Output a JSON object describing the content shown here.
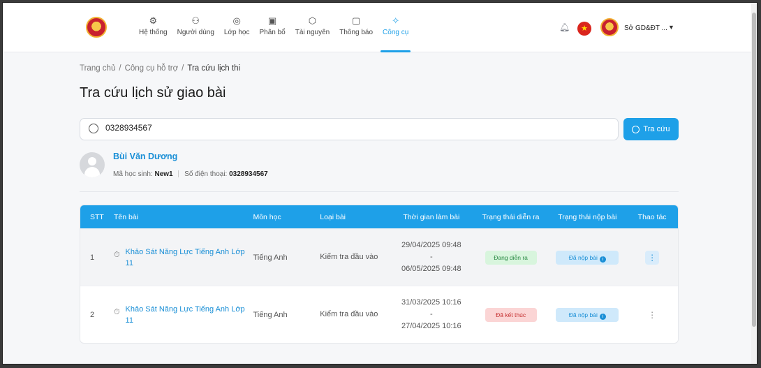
{
  "header": {
    "nav": [
      {
        "label": "Hệ thống",
        "icon": "gear-icon",
        "glyph": "⚙"
      },
      {
        "label": "Người dùng",
        "icon": "users-icon",
        "glyph": "⚇"
      },
      {
        "label": "Lớp học",
        "icon": "graduation-cap-icon",
        "glyph": "◎"
      },
      {
        "label": "Phân bổ",
        "icon": "allocation-icon",
        "glyph": "▣"
      },
      {
        "label": "Tài nguyên",
        "icon": "box-icon",
        "glyph": "⬡"
      },
      {
        "label": "Thông báo",
        "icon": "notification-icon",
        "glyph": "▢"
      },
      {
        "label": "Công cụ",
        "icon": "magic-wand-icon",
        "glyph": "✧"
      }
    ],
    "active_nav": "Công cụ",
    "user_name": "Sở GD&ĐT ...",
    "accent_color": "#1ea0e8"
  },
  "breadcrumb": [
    "Trang chủ",
    "/",
    "Công cụ hỗ trợ",
    "/",
    "Tra cứu lịch thi"
  ],
  "page_title": "Tra cứu lịch sử giao bài",
  "search": {
    "value": "0328934567",
    "button_label": "Tra cứu"
  },
  "student": {
    "name": "Bùi Văn Dương",
    "id_label": "Mã học sinh:",
    "id_value": "New1",
    "phone_label": "Số điện thoại:",
    "phone_value": "0328934567"
  },
  "table": {
    "columns": [
      "STT",
      "Tên bài",
      "Môn học",
      "Loại bài",
      "Thời gian làm bài",
      "Trạng thái diễn ra",
      "Trạng thái nộp bài",
      "Thao tác"
    ],
    "rows": [
      {
        "stt": "1",
        "name": "Khảo Sát Năng Lực Tiếng Anh Lớp 11",
        "subject": "Tiếng Anh",
        "type": "Kiểm tra đầu vào",
        "start": "29/04/2025 09:48",
        "dash": "-",
        "end": "06/05/2025 09:48",
        "status": "Đang diễn ra",
        "submit": "Đã nộp bài"
      },
      {
        "stt": "2",
        "name": "Khảo Sát Năng Lực Tiếng Anh Lớp 11",
        "subject": "Tiếng Anh",
        "type": "Kiểm tra đầu vào",
        "start": "31/03/2025 10:16",
        "dash": "-",
        "end": "27/04/2025 10:16",
        "status": "Đã kết thúc",
        "submit": "Đã nộp bài"
      }
    ]
  }
}
